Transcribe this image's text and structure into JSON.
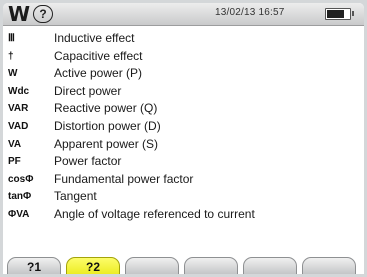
{
  "status_bar": {
    "app_icon": "W",
    "help_icon": "?",
    "datetime": "13/02/13 16:57",
    "battery_level": 0.75
  },
  "legend": [
    {
      "symbol": "Ⅲ",
      "description": "Inductive effect"
    },
    {
      "symbol": "†",
      "description": "Capacitive effect"
    },
    {
      "symbol": "W",
      "description": "Active power (P)"
    },
    {
      "symbol": "Wdc",
      "description": "Direct power"
    },
    {
      "symbol": "VAR",
      "description": "Reactive power (Q)"
    },
    {
      "symbol": "VAD",
      "description": "Distortion power (D)"
    },
    {
      "symbol": "VA",
      "description": "Apparent power (S)"
    },
    {
      "symbol": "PF",
      "description": "Power factor"
    },
    {
      "symbol": "cosΦ",
      "description": "Fundamental power factor"
    },
    {
      "symbol": "tanΦ",
      "description": "Tangent"
    },
    {
      "symbol": "ΦVA",
      "description": "Angle of voltage referenced to current"
    }
  ],
  "softkeys": [
    {
      "label": "?1",
      "active": false
    },
    {
      "label": "?2",
      "active": true
    },
    {
      "label": "",
      "active": false
    },
    {
      "label": "",
      "active": false
    },
    {
      "label": "",
      "active": false
    },
    {
      "label": "",
      "active": false
    }
  ],
  "colors": {
    "softkey_active": "#fdfd6a",
    "softkey_inactive": "#c9cbcd"
  }
}
